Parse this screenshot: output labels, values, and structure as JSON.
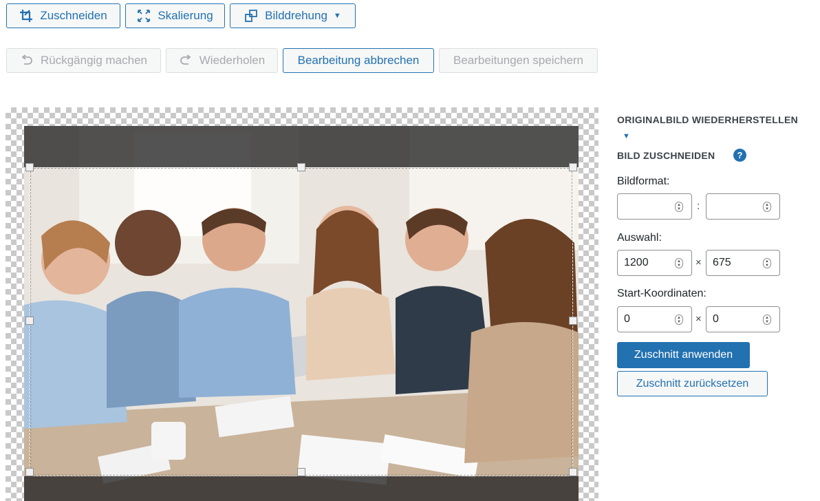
{
  "toolbar": {
    "crop_label": "Zuschneiden",
    "scale_label": "Skalierung",
    "rotate_label": "Bilddrehung",
    "crop_icon": "crop-icon",
    "scale_icon": "scale-icon",
    "rotate_icon": "rotate-icon"
  },
  "actions": {
    "undo_label": "Rückgängig machen",
    "redo_label": "Wiederholen",
    "cancel_label": "Bearbeitung abbrechen",
    "save_label": "Bearbeitungen speichern"
  },
  "sidebar": {
    "restore_heading": "ORIGINALBILD WIEDERHERSTELLEN",
    "crop_heading": "BILD ZUSCHNEIDEN",
    "help_glyph": "?",
    "aspect_label": "Bildformat:",
    "aspect_width": "",
    "aspect_height": "",
    "aspect_separator": ":",
    "selection_label": "Auswahl:",
    "selection_width": "1200",
    "selection_height": "675",
    "selection_separator": "×",
    "start_label": "Start-Koordinaten:",
    "start_x": "0",
    "start_y": "0",
    "start_separator": "×",
    "apply_label": "Zuschnitt anwenden",
    "reset_label": "Zuschnitt zurücksetzen"
  },
  "colors": {
    "accent": "#2271b1",
    "disabled": "#a7aaad"
  }
}
